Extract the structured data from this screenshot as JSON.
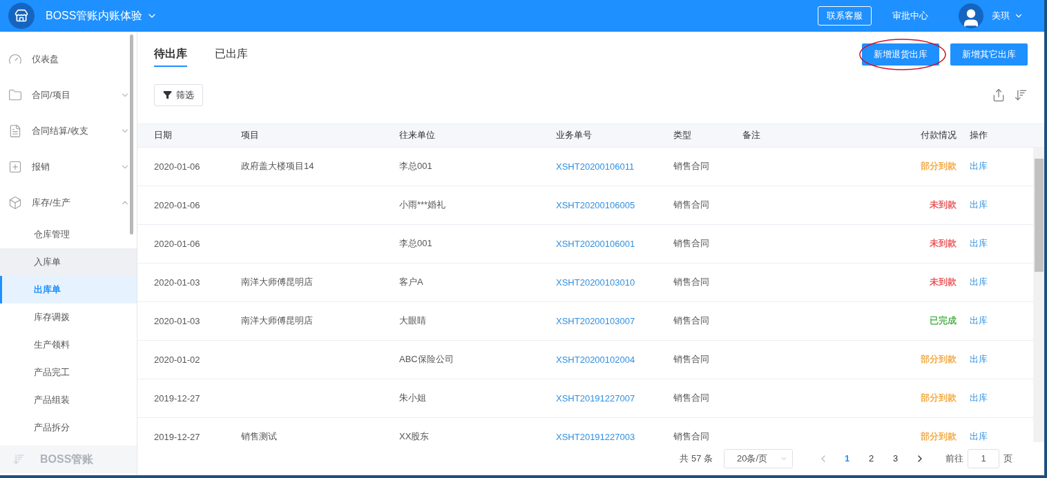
{
  "header": {
    "title": "BOSS管账内账体验",
    "contact_button": "联系客服",
    "approval_link": "审批中心",
    "user_name": "美琪"
  },
  "sidebar": {
    "items": [
      {
        "label": "仪表盘",
        "expanded": false,
        "has_children": false,
        "selected": false
      },
      {
        "label": "合同/项目",
        "expanded": false,
        "has_children": true,
        "selected": false
      },
      {
        "label": "合同结算/收支",
        "expanded": false,
        "has_children": true,
        "selected": false
      },
      {
        "label": "报销",
        "expanded": false,
        "has_children": true,
        "selected": false
      },
      {
        "label": "库存/生产",
        "expanded": true,
        "has_children": true,
        "selected": false,
        "children": [
          {
            "label": "仓库管理",
            "selected": false,
            "hovered": false
          },
          {
            "label": "入库单",
            "selected": false,
            "hovered": true
          },
          {
            "label": "出库单",
            "selected": true,
            "hovered": false
          },
          {
            "label": "库存调拨",
            "selected": false,
            "hovered": false
          },
          {
            "label": "生产领料",
            "selected": false,
            "hovered": false
          },
          {
            "label": "产品完工",
            "selected": false,
            "hovered": false
          },
          {
            "label": "产品组装",
            "selected": false,
            "hovered": false
          },
          {
            "label": "产品拆分",
            "selected": false,
            "hovered": false
          }
        ]
      }
    ],
    "footer_label": "BOSS管账"
  },
  "tabs": [
    {
      "label": "待出库",
      "selected": true
    },
    {
      "label": "已出库",
      "selected": false
    }
  ],
  "action_buttons": [
    {
      "label": "新增退货出库",
      "circled": true
    },
    {
      "label": "新增其它出库",
      "circled": false
    }
  ],
  "filter_button": "筛选",
  "table": {
    "columns": [
      "日期",
      "项目",
      "往来单位",
      "业务单号",
      "类型",
      "备注",
      "付款情况",
      "操作"
    ],
    "rows": [
      {
        "date": "2020-01-06",
        "project": "政府盖大楼项目14",
        "partner": "李总001",
        "number": "XSHT20200106011",
        "type": "销售合同",
        "note": "",
        "payment": {
          "text": "部分到款",
          "color": "#f0a030"
        },
        "action": "出库"
      },
      {
        "date": "2020-01-06",
        "project": "",
        "partner": "小雨***婚礼",
        "number": "XSHT20200106005",
        "type": "销售合同",
        "note": "",
        "payment": {
          "text": "未到款",
          "color": "#e8464a"
        },
        "action": "出库"
      },
      {
        "date": "2020-01-06",
        "project": "",
        "partner": "李总001",
        "number": "XSHT20200106001",
        "type": "销售合同",
        "note": "",
        "payment": {
          "text": "未到款",
          "color": "#e8464a"
        },
        "action": "出库"
      },
      {
        "date": "2020-01-03",
        "project": "南洋大师傅昆明店",
        "partner": "客户A",
        "number": "XSHT20200103010",
        "type": "销售合同",
        "note": "",
        "payment": {
          "text": "未到款",
          "color": "#e8464a"
        },
        "action": "出库"
      },
      {
        "date": "2020-01-03",
        "project": "南洋大师傅昆明店",
        "partner": "大眼睛",
        "number": "XSHT20200103007",
        "type": "销售合同",
        "note": "",
        "payment": {
          "text": "已完成",
          "color": "#3aaa3a"
        },
        "action": "出库"
      },
      {
        "date": "2020-01-02",
        "project": "",
        "partner": "ABC保险公司",
        "number": "XSHT20200102004",
        "type": "销售合同",
        "note": "",
        "payment": {
          "text": "部分到款",
          "color": "#f0a030"
        },
        "action": "出库"
      },
      {
        "date": "2019-12-27",
        "project": "",
        "partner": "朱小姐",
        "number": "XSHT20191227007",
        "type": "销售合同",
        "note": "",
        "payment": {
          "text": "部分到款",
          "color": "#f0a030"
        },
        "action": "出库"
      },
      {
        "date": "2019-12-27",
        "project": "销售测试",
        "partner": "XX股东",
        "number": "XSHT20191227003",
        "type": "销售合同",
        "note": "",
        "payment": {
          "text": "部分到款",
          "color": "#f0a030"
        },
        "action": "出库"
      }
    ]
  },
  "pagination": {
    "total": "共 57 条",
    "page_size": "20条/页",
    "pages": [
      {
        "label": "1",
        "selected": true
      },
      {
        "label": "2",
        "selected": false
      },
      {
        "label": "3",
        "selected": false
      }
    ],
    "goto_label": "前往",
    "goto_value": "1",
    "page_unit": "页"
  }
}
